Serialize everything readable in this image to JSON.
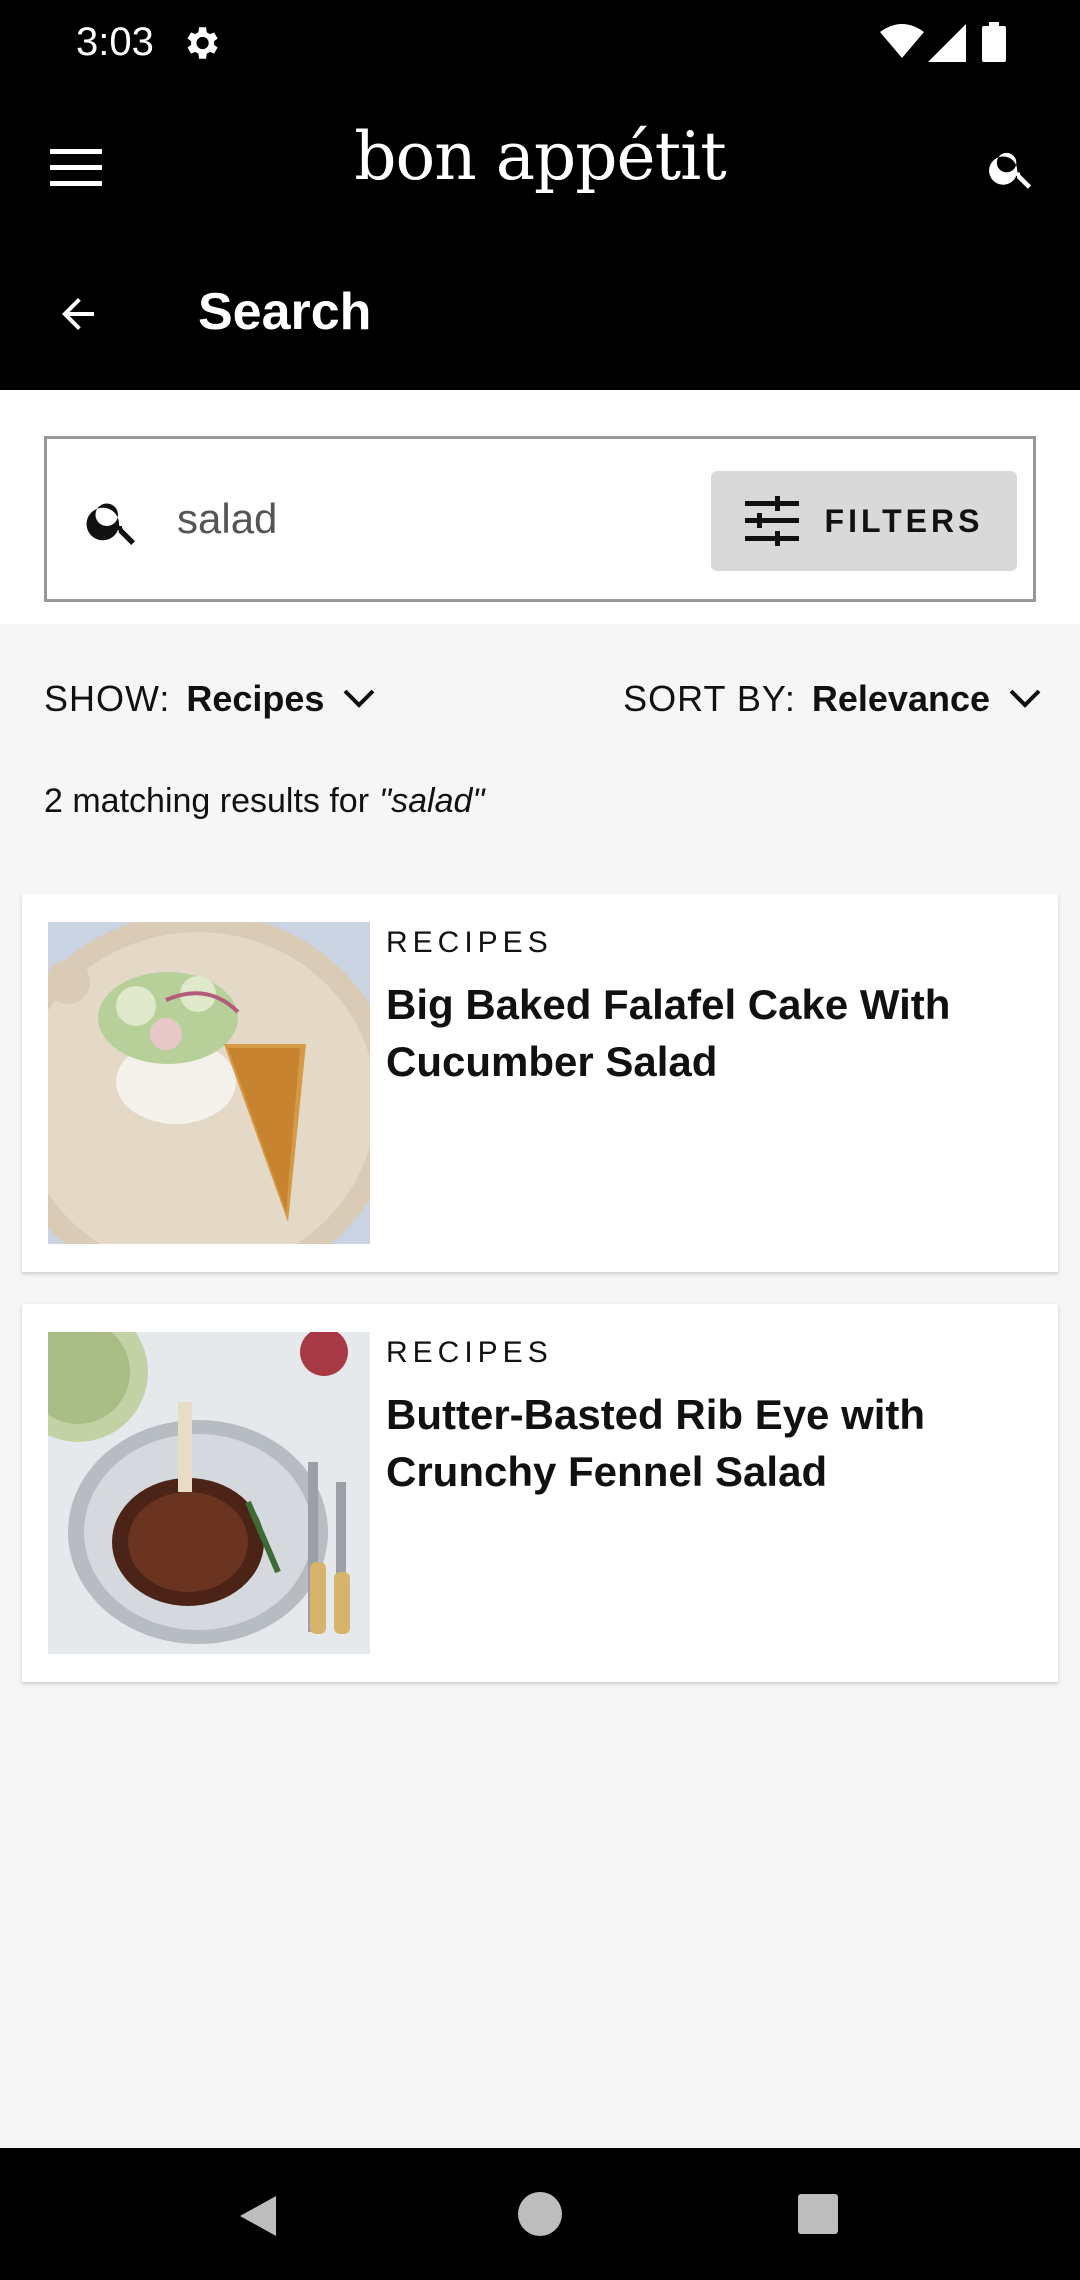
{
  "status_bar": {
    "time": "3:03"
  },
  "app_bar": {
    "logo": "bon appétit",
    "title": "Search"
  },
  "search": {
    "query": "salad",
    "filters_label": "FILTERS"
  },
  "controls": {
    "show_label": "SHOW:",
    "show_value": "Recipes",
    "sort_label": "SORT BY:",
    "sort_value": "Relevance"
  },
  "results": {
    "count_text": "2 matching results for",
    "query_text": "\"salad\"",
    "items": [
      {
        "tag": "RECIPES",
        "title": "Big Baked Falafel Cake With Cucumber Salad"
      },
      {
        "tag": "RECIPES",
        "title": "Butter-Basted Rib Eye with Crunchy Fennel Salad"
      }
    ]
  }
}
